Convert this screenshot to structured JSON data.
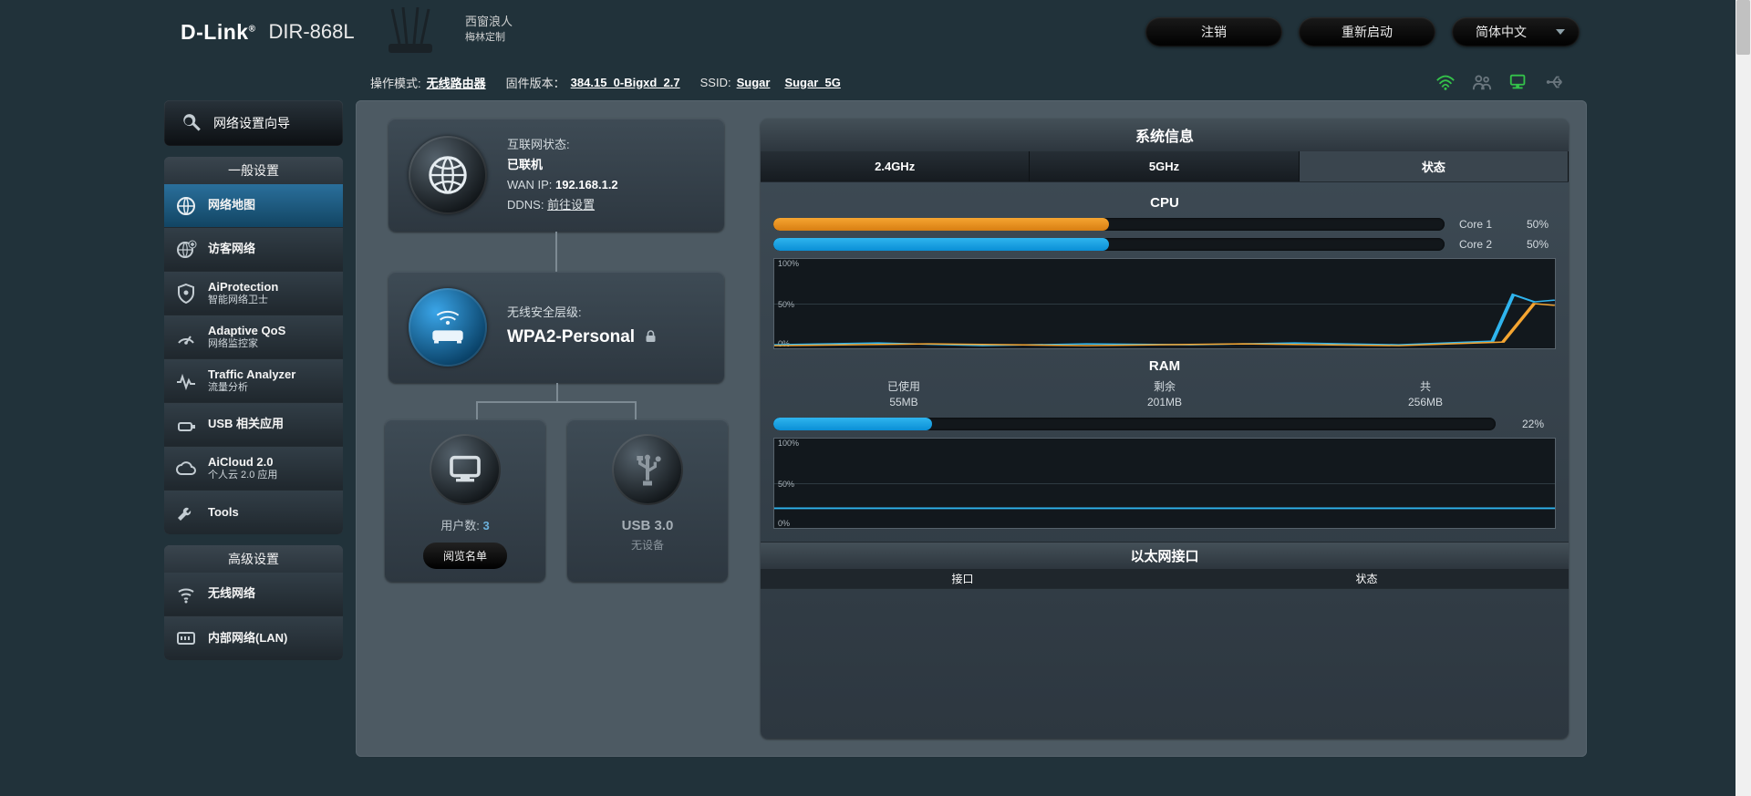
{
  "header": {
    "logo": "D-Link",
    "model": "DIR-868L",
    "decor_line1": "西窗浪人",
    "decor_line2": "梅林定制",
    "logout": "注销",
    "reboot": "重新启动",
    "language": "简体中文"
  },
  "infobar": {
    "mode_label": "操作模式:",
    "mode_value": "无线路由器",
    "fw_label": "固件版本：",
    "fw_value": "384.15_0-Bigxd_2.7",
    "ssid_label": "SSID:",
    "ssid_1": "Sugar",
    "ssid_2": "Sugar_5G"
  },
  "sidebar": {
    "wizard": "网络设置向导",
    "general_title": "一般设置",
    "general": [
      {
        "title": "网络地图",
        "sub": ""
      },
      {
        "title": "访客网络",
        "sub": ""
      },
      {
        "title": "AiProtection",
        "sub": "智能网络卫士"
      },
      {
        "title": "Adaptive QoS",
        "sub": "网络监控家"
      },
      {
        "title": "Traffic Analyzer",
        "sub": "流量分析"
      },
      {
        "title": "USB 相关应用",
        "sub": ""
      },
      {
        "title": "AiCloud 2.0",
        "sub": "个人云 2.0 应用"
      },
      {
        "title": "Tools",
        "sub": ""
      }
    ],
    "advanced_title": "高级设置",
    "advanced": [
      {
        "title": "无线网络"
      },
      {
        "title": "内部网络(LAN)"
      }
    ]
  },
  "net": {
    "internet_status_label": "互联网状态:",
    "internet_status_value": "已联机",
    "wan_ip_label": "WAN IP:",
    "wan_ip_value": "192.168.1.2",
    "ddns_label": "DDNS:",
    "ddns_link": "前往设置",
    "sec_label": "无线安全层级:",
    "sec_value": "WPA2-Personal",
    "users_label": "用户数:",
    "users_value": "3",
    "users_btn": "阅览名单",
    "usb_title": "USB 3.0",
    "usb_sub": "无设备"
  },
  "sys": {
    "title": "系统信息",
    "tabs": {
      "t24": "2.4GHz",
      "t5": "5GHz",
      "tst": "状态"
    },
    "cpu_title": "CPU",
    "cores": [
      {
        "label": "Core 1",
        "pct": 50,
        "color": "orange"
      },
      {
        "label": "Core 2",
        "pct": 50,
        "color": "blue"
      }
    ],
    "ram_title": "RAM",
    "ram_used_label": "已使用",
    "ram_used_value": "55MB",
    "ram_free_label": "剩余",
    "ram_free_value": "201MB",
    "ram_total_label": "共",
    "ram_total_value": "256MB",
    "ram_pct": 22,
    "eth_title": "以太网接口",
    "eth_col1": "接口",
    "eth_col2": "状态"
  }
}
